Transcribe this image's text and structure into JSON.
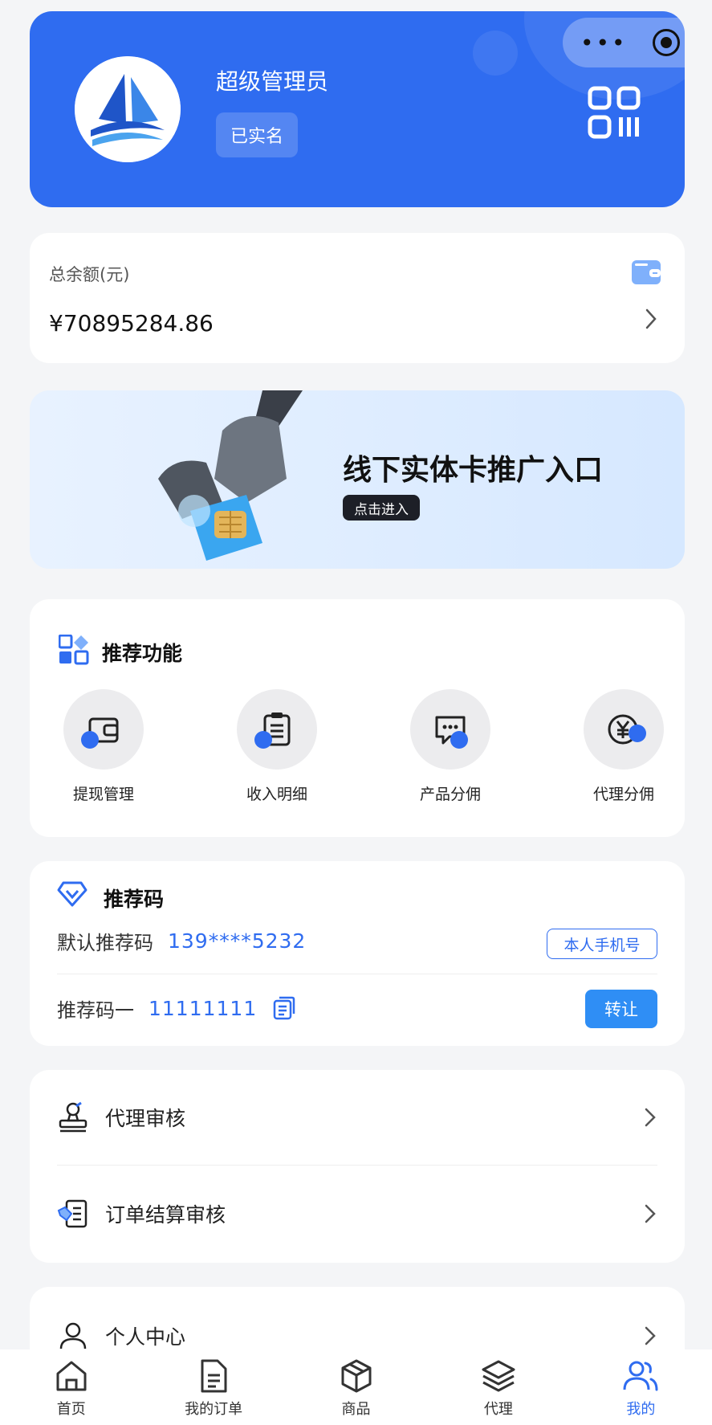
{
  "header": {
    "username": "超级管理员",
    "verify_label": "已实名",
    "capsule_more": "•••"
  },
  "balance": {
    "label": "总余额(元)",
    "amount": "¥70895284.86"
  },
  "banner": {
    "title": "线下实体卡推广入口",
    "button": "点击进入"
  },
  "features": {
    "title": "推荐功能",
    "items": [
      {
        "label": "提现管理",
        "icon": "wallet-icon"
      },
      {
        "label": "收入明细",
        "icon": "clipboard-icon"
      },
      {
        "label": "产品分佣",
        "icon": "chat-icon"
      },
      {
        "label": "代理分佣",
        "icon": "yen-icon"
      }
    ]
  },
  "refcode": {
    "title": "推荐码",
    "default_label": "默认推荐码",
    "default_value": "139****5232",
    "phone_button": "本人手机号",
    "code1_label": "推荐码一",
    "code1_value": "11111111",
    "transfer_button": "转让"
  },
  "audit": {
    "items": [
      {
        "label": "代理审核",
        "icon": "stamp-icon"
      },
      {
        "label": "订单结算审核",
        "icon": "handshake-doc-icon"
      }
    ]
  },
  "personal": {
    "label": "个人中心",
    "icon": "user-icon"
  },
  "tabbar": {
    "items": [
      {
        "label": "首页",
        "icon": "home-icon",
        "active": false
      },
      {
        "label": "我的订单",
        "icon": "document-icon",
        "active": false
      },
      {
        "label": "商品",
        "icon": "box-icon",
        "active": false
      },
      {
        "label": "代理",
        "icon": "layers-icon",
        "active": false
      },
      {
        "label": "我的",
        "icon": "users-icon",
        "active": true
      }
    ]
  },
  "colors": {
    "primary": "#2f6cf0",
    "button_blue": "#2f8ef5",
    "page_bg": "#f4f5f7"
  }
}
